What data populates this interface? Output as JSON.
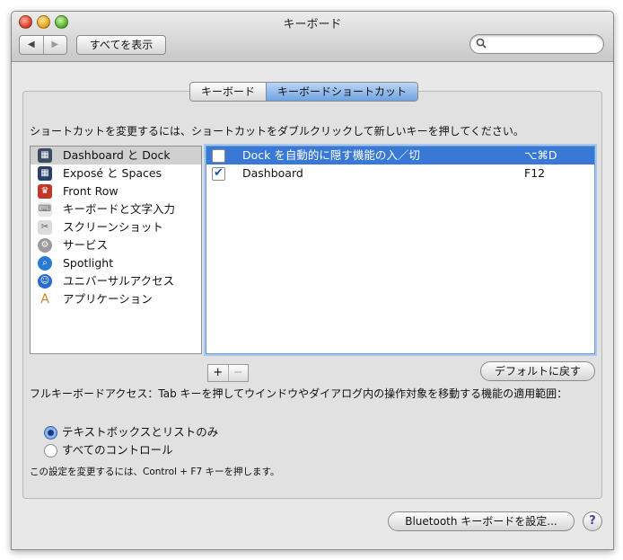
{
  "window": {
    "title": "キーボード"
  },
  "toolbar": {
    "back": "◀",
    "forward": "▶",
    "show_all": "すべてを表示",
    "search_placeholder": ""
  },
  "tabs": [
    {
      "label": "キーボード",
      "selected": false
    },
    {
      "label": "キーボードショートカット",
      "selected": true
    }
  ],
  "instructions": "ショートカットを変更するには、ショートカットをダブルクリックして新しいキーを押してください。",
  "categories": [
    {
      "label": "Dashboard と Dock",
      "icon": "dashboard-dock-icon",
      "selected": true
    },
    {
      "label": "Exposé と Spaces",
      "icon": "expose-spaces-icon"
    },
    {
      "label": "Front Row",
      "icon": "front-row-icon"
    },
    {
      "label": "キーボードと文字入力",
      "icon": "keyboard-input-icon"
    },
    {
      "label": "スクリーンショット",
      "icon": "screenshot-icon"
    },
    {
      "label": "サービス",
      "icon": "services-gear-icon"
    },
    {
      "label": "Spotlight",
      "icon": "spotlight-icon"
    },
    {
      "label": "ユニバーサルアクセス",
      "icon": "universal-access-icon"
    },
    {
      "label": "アプリケーション",
      "icon": "applications-icon"
    }
  ],
  "shortcuts": [
    {
      "name": "Dock を自動的に隠す機能の入／切",
      "key": "⌥⌘D",
      "checked": false,
      "selected": true
    },
    {
      "name": "Dashboard",
      "key": "F12",
      "checked": true,
      "selected": false
    }
  ],
  "add_button": "+",
  "remove_button": "−",
  "restore_defaults": "デフォルトに戻す",
  "full_keyboard_access": "フルキーボードアクセス：Tab キーを押してウインドウやダイアログ内の操作対象を移動する機能の適用範囲：",
  "radio_options": [
    {
      "label": "テキストボックスとリストのみ",
      "selected": true
    },
    {
      "label": "すべてのコントロール",
      "selected": false
    }
  ],
  "note": "この設定を変更するには、Control + F7 キーを押します。",
  "bluetooth_button": "Bluetooth キーボードを設定...",
  "help": "?"
}
